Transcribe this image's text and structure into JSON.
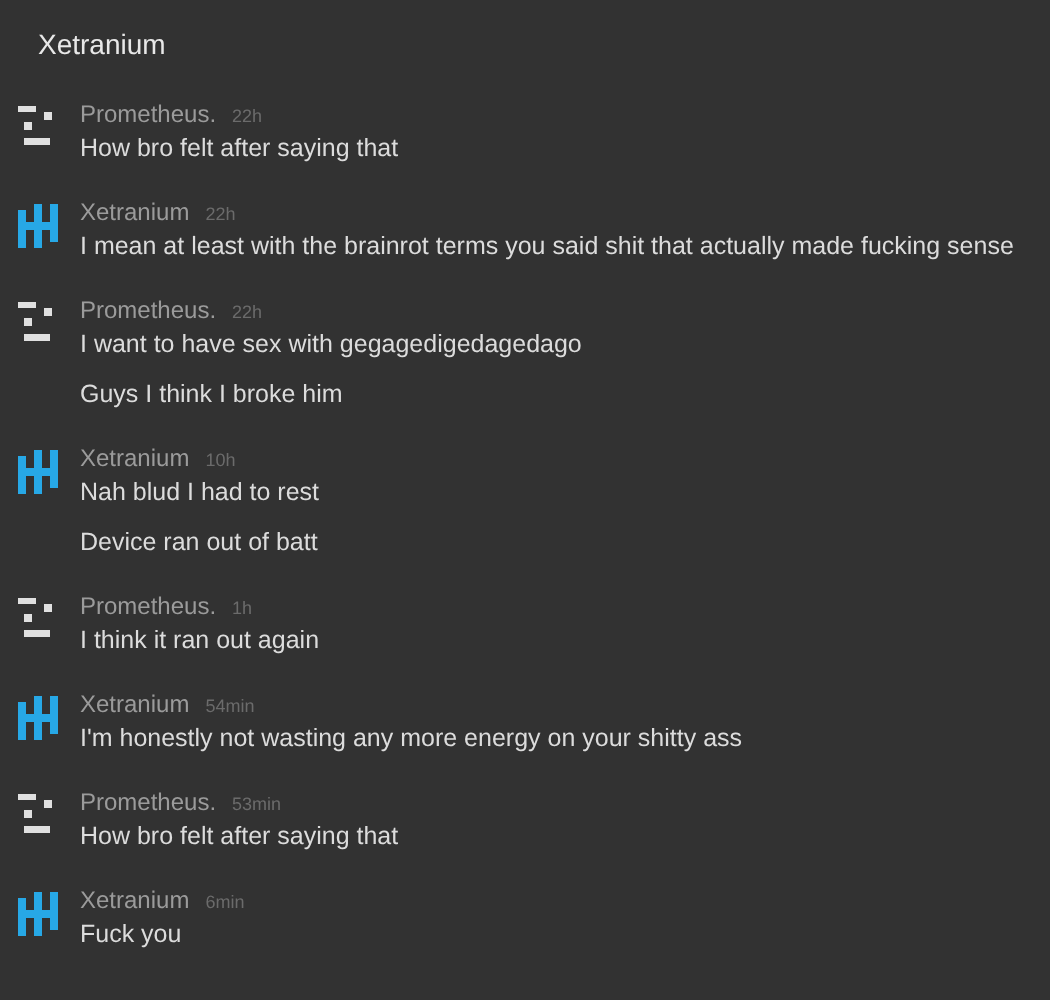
{
  "header": {
    "title": "Xetranium"
  },
  "messages": [
    {
      "author": "Prometheus.",
      "kind": "dashes",
      "time": "22h",
      "lines": [
        "How bro felt after saying that"
      ]
    },
    {
      "author": "Xetranium",
      "kind": "bars",
      "time": "22h",
      "lines": [
        "I mean at least with the brainrot terms you said shit that actually made fucking sense"
      ]
    },
    {
      "author": "Prometheus.",
      "kind": "dashes",
      "time": "22h",
      "lines": [
        "I want to have sex with gegagedigedagedago",
        "Guys I think I broke him"
      ]
    },
    {
      "author": "Xetranium",
      "kind": "bars",
      "time": "10h",
      "lines": [
        "Nah blud I had to rest",
        "Device ran out of batt"
      ]
    },
    {
      "author": "Prometheus.",
      "kind": "dashes",
      "time": "1h",
      "lines": [
        "I think it ran out again"
      ]
    },
    {
      "author": "Xetranium",
      "kind": "bars",
      "time": "54min",
      "lines": [
        "I'm honestly not wasting any more energy on your shitty ass"
      ]
    },
    {
      "author": "Prometheus.",
      "kind": "dashes",
      "time": "53min",
      "lines": [
        "How bro felt after saying that"
      ]
    },
    {
      "author": "Xetranium",
      "kind": "bars",
      "time": "6min",
      "lines": [
        "Fuck you"
      ]
    }
  ]
}
